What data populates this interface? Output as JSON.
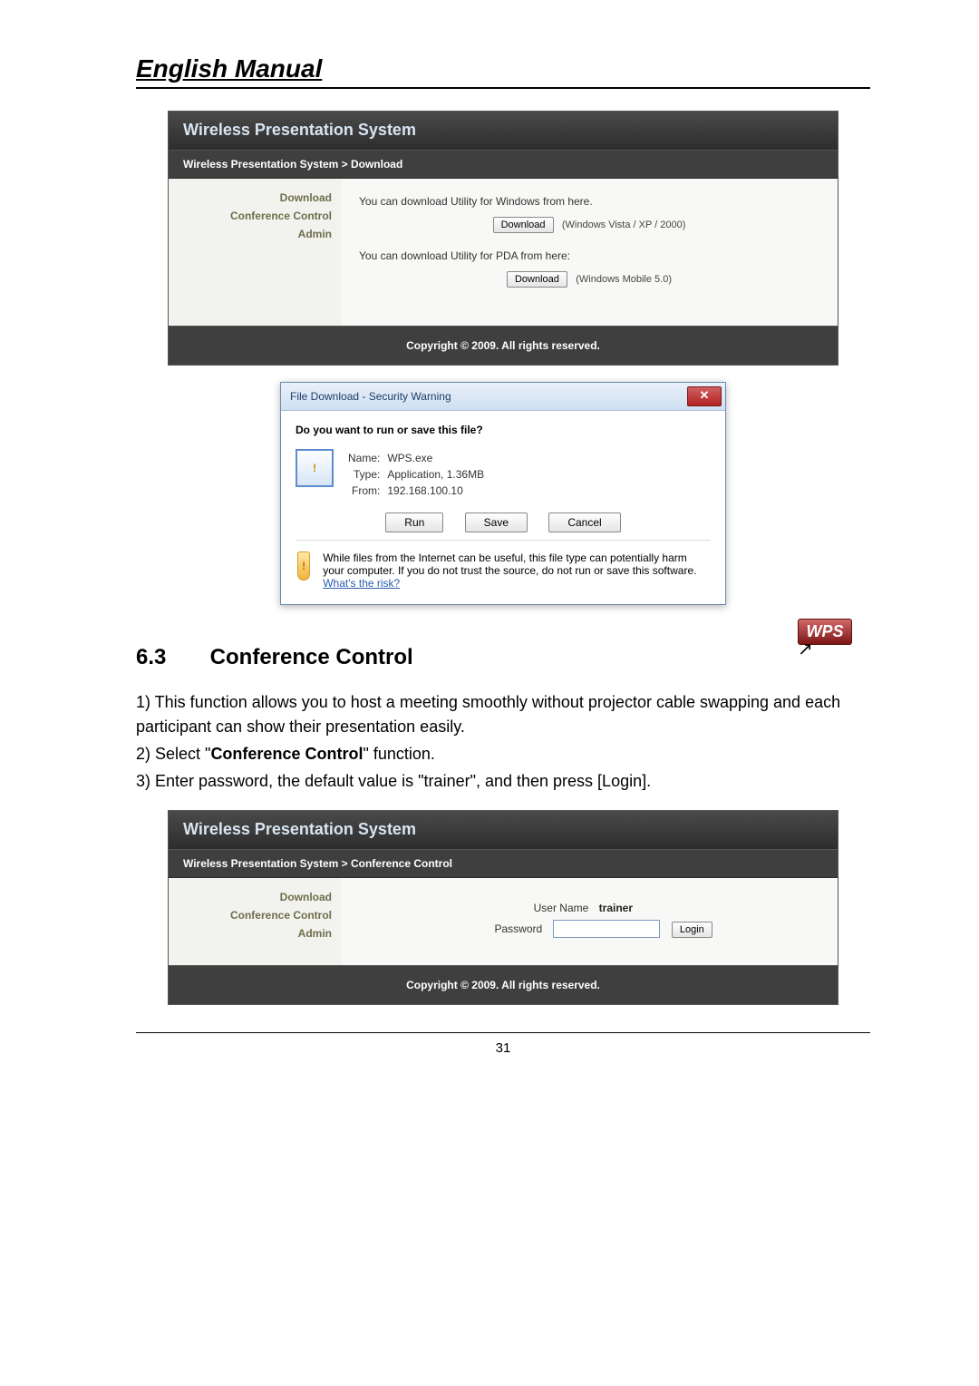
{
  "document_title": "English Manual",
  "screenshot1": {
    "title": "Wireless Presentation System",
    "breadcrumb": "Wireless Presentation System > Download",
    "sidebar": {
      "download": "Download",
      "conference": "Conference Control",
      "admin": "Admin"
    },
    "text_win": "You can download Utility for Windows from here.",
    "btn_download": "Download",
    "note_win": "(Windows Vista / XP / 2000)",
    "text_pda": "You can download Utility for PDA from here:",
    "note_pda": "(Windows Mobile 5.0)",
    "footer": "Copyright © 2009. All rights reserved."
  },
  "dialog": {
    "title": "File Download - Security Warning",
    "question": "Do you want to run or save this file?",
    "name_label": "Name:",
    "name_value": "WPS.exe",
    "type_label": "Type:",
    "type_value": "Application, 1.36MB",
    "from_label": "From:",
    "from_value": "192.168.100.10",
    "run": "Run",
    "save": "Save",
    "cancel": "Cancel",
    "warn_text": "While files from the Internet can be useful, this file type can potentially harm your computer. If you do not trust the source, do not run or save this software. ",
    "risk_link": "What's the risk?"
  },
  "wps_badge": "WPS",
  "section": {
    "number": "6.3",
    "title": "Conference Control",
    "line1": "1)  This function allows you to host a meeting smoothly without projector cable swapping and each participant can show their presentation easily.",
    "line2a": "2) Select \"",
    "line2b": "Conference Control",
    "line2c": "\" function.",
    "line3": "3)  Enter password, the default value is \"trainer\", and then press [Login]."
  },
  "screenshot2": {
    "title": "Wireless Presentation System",
    "breadcrumb": "Wireless Presentation System > Conference Control",
    "sidebar": {
      "download": "Download",
      "conference": "Conference Control",
      "admin": "Admin"
    },
    "user_label": "User Name",
    "user_value": "trainer",
    "pass_label": "Password",
    "login": "Login",
    "footer": "Copyright © 2009. All rights reserved."
  },
  "page_number": "31"
}
